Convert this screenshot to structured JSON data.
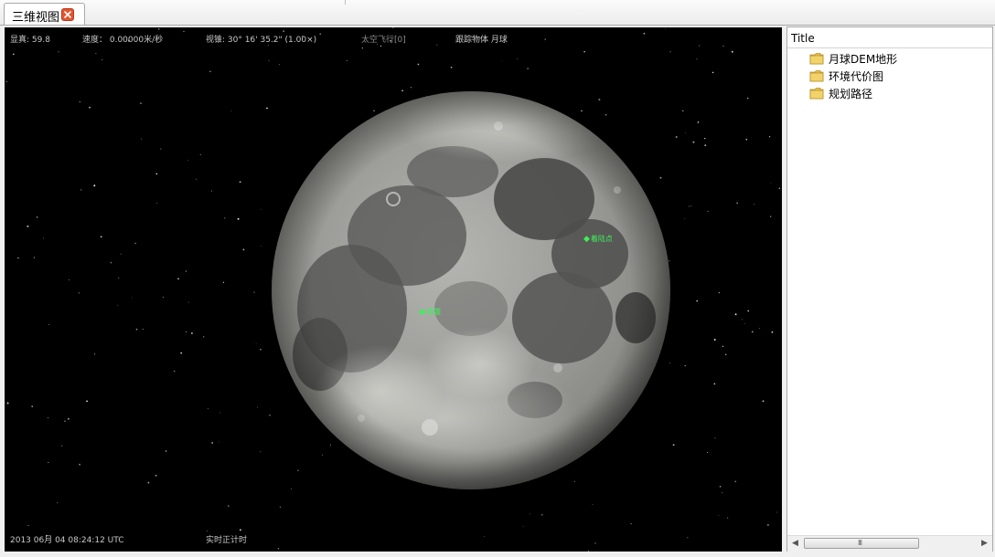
{
  "tab": {
    "label": "三维视图",
    "close_icon": "close-icon"
  },
  "hud": {
    "fps": "显真: 59.8",
    "speed": "速度： 0.00000米/秒",
    "view": "视锥: 30° 16' 35.2\" (1.00×)",
    "flight": "太空飞行[0]",
    "tracking": "跟踪物体 月球",
    "datetime": "2013 06月 04 08:24:12 UTC",
    "time_mode": "实时正计时"
  },
  "markers": [
    {
      "label": "嫦娥"
    },
    {
      "label": "着陆点"
    }
  ],
  "panel": {
    "title": "Title",
    "items": [
      {
        "label": "月球DEM地形",
        "icon": "folder-icon"
      },
      {
        "label": "环境代价图",
        "icon": "folder-icon"
      },
      {
        "label": "规划路径",
        "icon": "folder-icon"
      }
    ],
    "scrollbar": {
      "grip": "III"
    }
  },
  "colors": {
    "viewport_bg": "#000000",
    "marker": "#3ef05a",
    "close": "#e2552f",
    "folder": "#e8c04a"
  }
}
